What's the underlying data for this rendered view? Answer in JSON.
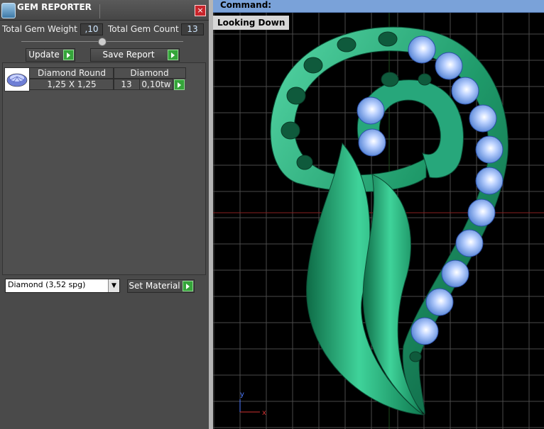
{
  "panel": {
    "title": "GEM REPORTER",
    "close": "×",
    "total_weight_label": "Total Gem Weight",
    "total_weight_value": ",10",
    "total_count_label": "Total Gem Count",
    "total_count_value": "13",
    "update_label": "Update",
    "save_report_label": "Save Report",
    "table": {
      "row": {
        "shape": "Diamond Round",
        "size": "1,25 X 1,25",
        "material": "Diamond",
        "count": "13",
        "weight": "0,10tw"
      }
    },
    "material_select": "Diamond      (3,52 spg)",
    "set_material_label": "Set Material"
  },
  "viewport": {
    "command_label": "Command:",
    "view_name": "Looking Down",
    "axis_y": "y",
    "axis_x": "x",
    "colors": {
      "pendant": "#1f9a6a",
      "gem": "#8fb4f0",
      "grid": "#5a5a5a"
    }
  }
}
